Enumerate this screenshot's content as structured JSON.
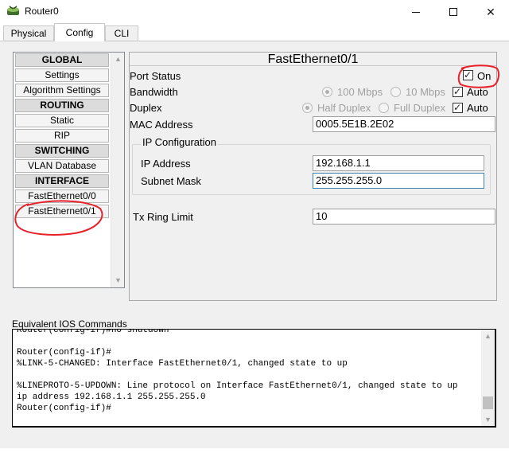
{
  "window": {
    "title": "Router0",
    "minimize_label": "",
    "maximize_label": "",
    "close_label": "✕"
  },
  "tabs": [
    {
      "label": "Physical",
      "active": false
    },
    {
      "label": "Config",
      "active": true
    },
    {
      "label": "CLI",
      "active": false
    }
  ],
  "nav": {
    "items": [
      {
        "label": "GLOBAL",
        "header": true
      },
      {
        "label": "Settings",
        "header": false
      },
      {
        "label": "Algorithm Settings",
        "header": false
      },
      {
        "label": "ROUTING",
        "header": true
      },
      {
        "label": "Static",
        "header": false
      },
      {
        "label": "RIP",
        "header": false
      },
      {
        "label": "SWITCHING",
        "header": true
      },
      {
        "label": "VLAN Database",
        "header": false
      },
      {
        "label": "INTERFACE",
        "header": true
      },
      {
        "label": "FastEthernet0/0",
        "header": false
      },
      {
        "label": "FastEthernet0/1",
        "header": false,
        "selected": true
      }
    ],
    "scroll_up": "▲",
    "scroll_down": "▼"
  },
  "interface_panel": {
    "title": "FastEthernet0/1",
    "port_status_label": "Port Status",
    "port_status_on_label": "On",
    "port_status_checked": true,
    "bandwidth_label": "Bandwidth",
    "bandwidth_100_label": "100 Mbps",
    "bandwidth_10_label": "10 Mbps",
    "bandwidth_selected": "100 Mbps",
    "bandwidth_auto_label": "Auto",
    "bandwidth_auto_checked": true,
    "duplex_label": "Duplex",
    "duplex_half_label": "Half Duplex",
    "duplex_full_label": "Full Duplex",
    "duplex_selected": "Half Duplex",
    "duplex_auto_label": "Auto",
    "duplex_auto_checked": true,
    "mac_address_label": "MAC Address",
    "mac_address_value": "0005.5E1B.2E02",
    "ip_config_title": "IP Configuration",
    "ip_address_label": "IP Address",
    "ip_address_value": "192.168.1.1",
    "subnet_mask_label": "Subnet Mask",
    "subnet_mask_value": "255.255.255.0",
    "tx_ring_limit_label": "Tx Ring Limit",
    "tx_ring_limit_value": "10"
  },
  "console": {
    "label": "Equivalent IOS Commands",
    "text": "Router(config-if)#no shutdown\n\nRouter(config-if)#\n%LINK-5-CHANGED: Interface FastEthernet0/1, changed state to up\n\n%LINEPROTO-5-UPDOWN: Line protocol on Interface FastEthernet0/1, changed state to up\nip address 192.168.1.1 255.255.255.0\nRouter(config-if)#"
  },
  "colors": {
    "annotation": "#e8202a",
    "nav_header_bg": "#dcdcdc",
    "panel_bg": "#f0f0f0"
  }
}
